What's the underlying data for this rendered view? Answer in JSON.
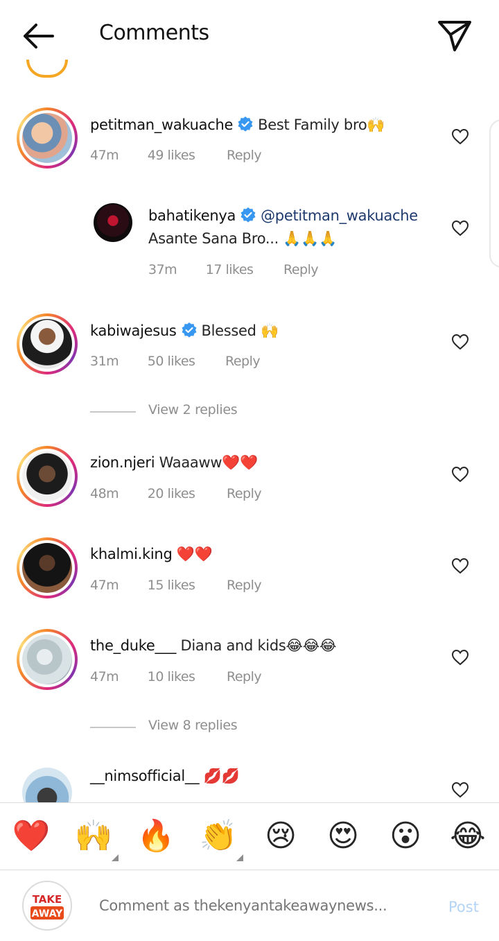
{
  "header": {
    "title": "Comments",
    "back_icon": "arrow-left-icon",
    "share_icon": "paper-plane-icon"
  },
  "colors": {
    "verified": "#3897f0",
    "meta": "#8e8e8e",
    "mention": "#1e3a6e",
    "post_disabled": "#b3d4f5"
  },
  "comments": [
    {
      "username": "petitman_wakuache",
      "verified": true,
      "text": "Best Family bro🙌",
      "time": "47m",
      "likes": "49 likes",
      "reply": "Reply"
    },
    {
      "username": "bahatikenya",
      "verified": true,
      "mention": "@petitman_wakuache",
      "text": "Asante Sana Bro... 🙏🙏🙏",
      "time": "37m",
      "likes": "17 likes",
      "reply": "Reply"
    },
    {
      "username": "kabiwajesus",
      "verified": true,
      "text": "Blessed 🙌",
      "time": "31m",
      "likes": "50 likes",
      "reply": "Reply"
    },
    {
      "username": "zion.njeri",
      "verified": false,
      "text": "Waaaww❤️❤️",
      "time": "48m",
      "likes": "20 likes",
      "reply": "Reply"
    },
    {
      "username": "khalmi.king",
      "verified": false,
      "text": "❤️❤️",
      "time": "47m",
      "likes": "15 likes",
      "reply": "Reply"
    },
    {
      "username": "the_duke___",
      "verified": false,
      "text": "Diana and kids😂😂😂",
      "time": "47m",
      "likes": "10 likes",
      "reply": "Reply"
    },
    {
      "username": "__nimsofficial__",
      "verified": false,
      "text": "💋💋"
    }
  ],
  "view_replies": [
    "View 2 replies",
    "View 8 replies"
  ],
  "emoji_bar": [
    "❤️",
    "🙌",
    "🔥",
    "👏",
    "😢",
    "😍",
    "😮",
    "😂"
  ],
  "composer": {
    "placeholder": "Comment as thekenyantakeawaynews...",
    "post_label": "Post",
    "logo_line1": "TAKE",
    "logo_line2": "AWAY"
  }
}
